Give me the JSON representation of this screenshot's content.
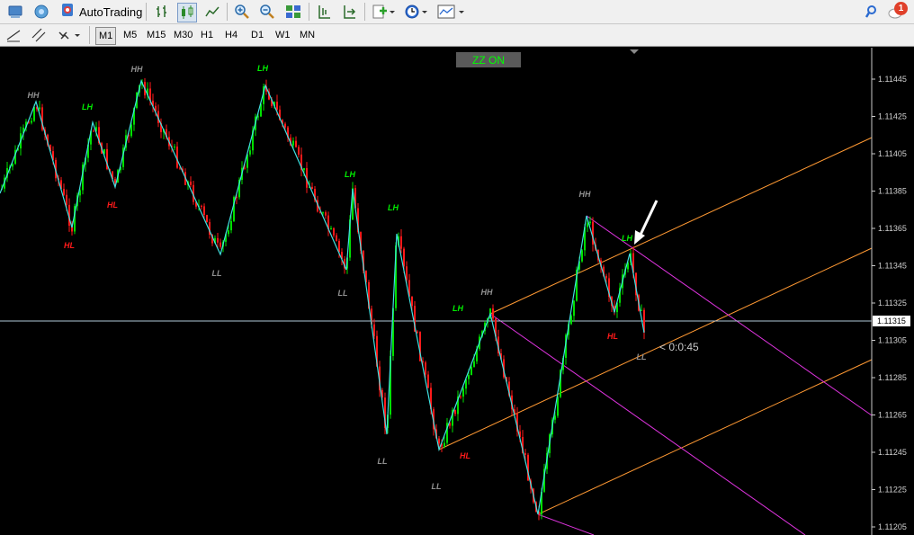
{
  "toolbar": {
    "autotrading_label": "AutoTrading",
    "notification_count": "1"
  },
  "timeframes": [
    "M1",
    "M5",
    "M15",
    "M30",
    "H1",
    "H4",
    "D1",
    "W1",
    "MN"
  ],
  "active_timeframe": "M1",
  "zz_button": "ZZ ON",
  "countdown": "< 0:0:45",
  "price_axis": {
    "labels": [
      "1.11445",
      "1.11425",
      "1.11405",
      "1.11385",
      "1.11365",
      "1.11345",
      "1.11325",
      "1.11305",
      "1.11285",
      "1.11265",
      "1.11245",
      "1.11225",
      "1.11205"
    ],
    "current_price": "1.11315"
  },
  "swing_labels": [
    {
      "text": "HH",
      "color": "#909090"
    },
    {
      "text": "HL",
      "color": "#ff1a1a"
    },
    {
      "text": "LH",
      "color": "#00ee00"
    },
    {
      "text": "HL",
      "color": "#ff1a1a"
    },
    {
      "text": "HH",
      "color": "#909090"
    },
    {
      "text": "LL",
      "color": "#909090"
    },
    {
      "text": "LH",
      "color": "#00ee00"
    },
    {
      "text": "LL",
      "color": "#909090"
    },
    {
      "text": "LH",
      "color": "#00ee00"
    },
    {
      "text": "LH",
      "color": "#00ee00"
    },
    {
      "text": "LL",
      "color": "#909090"
    },
    {
      "text": "LL",
      "color": "#909090"
    },
    {
      "text": "HL",
      "color": "#ff1a1a"
    },
    {
      "text": "LH",
      "color": "#00ee00"
    },
    {
      "text": "HH",
      "color": "#909090"
    },
    {
      "text": "HH",
      "color": "#909090"
    },
    {
      "text": "LH",
      "color": "#00ee00"
    },
    {
      "text": "HL",
      "color": "#ff1a1a"
    },
    {
      "text": "LL",
      "color": "#909090"
    }
  ],
  "colors": {
    "bull": "#00e000",
    "bear": "#ff1a1a",
    "zigzag": "#40e0e0",
    "channel_orange": "#ff9933",
    "channel_magenta": "#dd33dd",
    "price_line": "#b0c8d8"
  },
  "icons": [
    "profiles-icon",
    "signal-icon",
    "autotrading-icon",
    "bar-chart-icon",
    "candlestick-icon",
    "line-chart-icon",
    "zoom-in-icon",
    "zoom-out-icon",
    "tile-windows-icon",
    "chart-shift-icon",
    "autoscroll-icon",
    "new-order-icon",
    "clock-icon",
    "templates-icon",
    "search-icon",
    "chat-icon",
    "crosshair-icon",
    "line-tool-icon",
    "channel-tool-icon",
    "arrows-icon"
  ]
}
